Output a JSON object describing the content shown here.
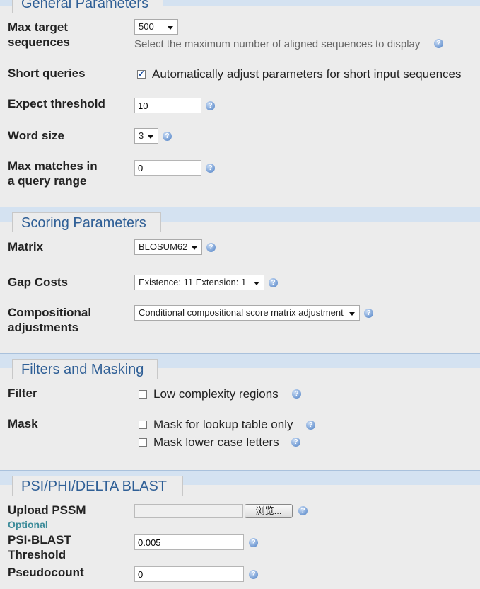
{
  "general": {
    "title": "General Parameters",
    "max_target": {
      "label": "Max target sequences",
      "label_line1": "Max target",
      "label_line2": "sequences",
      "value": "500",
      "description": "Select the maximum number of aligned sequences to display"
    },
    "short_queries": {
      "label": "Short queries",
      "checked": true,
      "text": "Automatically adjust parameters for short input sequences"
    },
    "expect": {
      "label": "Expect threshold",
      "value": "10"
    },
    "word_size": {
      "label": "Word size",
      "value": "3"
    },
    "max_matches": {
      "label_line1": "Max matches in",
      "label_line2": "a query range",
      "value": "0"
    }
  },
  "scoring": {
    "title": "Scoring Parameters",
    "matrix": {
      "label": "Matrix",
      "value": "BLOSUM62"
    },
    "gap_costs": {
      "label": "Gap Costs",
      "value": "Existence: 11 Extension: 1"
    },
    "compositional": {
      "label_line1": "Compositional",
      "label_line2": "adjustments",
      "value": "Conditional compositional score matrix adjustment"
    }
  },
  "filters": {
    "title": "Filters and Masking",
    "filter": {
      "label": "Filter",
      "option": "Low complexity regions",
      "checked": false
    },
    "mask": {
      "label": "Mask",
      "option1": "Mask for lookup table only",
      "option2": "Mask lower case letters",
      "checked1": false,
      "checked2": false
    }
  },
  "psi": {
    "title": "PSI/PHI/DELTA BLAST",
    "upload": {
      "label": "Upload PSSM",
      "optional": "Optional",
      "browse": "浏览..."
    },
    "threshold": {
      "label_line1": "PSI-BLAST",
      "label_line2": "Threshold",
      "value": "0.005"
    },
    "pseudocount": {
      "label": "Pseudocount",
      "value": "0"
    }
  },
  "icons": {
    "help": "help-icon",
    "dropdown": "chevron-down-icon",
    "checkbox": "checkbox"
  },
  "colors": {
    "band": "#d4e2f1",
    "legend_text": "#2f5f96",
    "optional_text": "#3d8c9a"
  }
}
